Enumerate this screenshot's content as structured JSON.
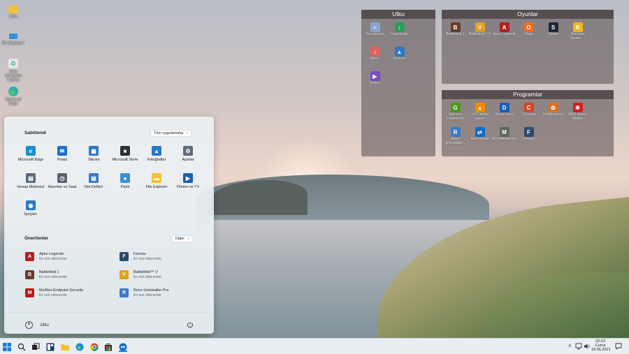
{
  "desktop": {
    "icons": [
      {
        "label": "Utku",
        "color": "#f2c233"
      },
      {
        "label": "Bu bilgisayar",
        "color": "#3a8fd8"
      },
      {
        "label": "Geri Dönüşüm Kutusu",
        "color": "#dfe6ea"
      },
      {
        "label": "Microsoft Edge",
        "color": "#1a8fd2"
      }
    ]
  },
  "fences": {
    "utku": {
      "title": "Utku",
      "items": [
        {
          "label": "Documents",
          "color": "#8aa4c8",
          "glyph": "≡"
        },
        {
          "label": "Downloads",
          "color": "#2e9e5a",
          "glyph": "↓"
        },
        {
          "label": "Music",
          "color": "#e0625c",
          "glyph": "♪"
        },
        {
          "label": "Pictures",
          "color": "#2a78c8",
          "glyph": "▲"
        },
        {
          "label": "Videos",
          "color": "#7b4bc2",
          "glyph": "▶"
        }
      ]
    },
    "oyunlar": {
      "title": "Oyunlar",
      "items": [
        {
          "label": "Battlefield 1",
          "color": "#6b3a2a",
          "glyph": "B"
        },
        {
          "label": "Battlefield™ V",
          "color": "#e0a020",
          "glyph": "V"
        },
        {
          "label": "Apex Legends",
          "color": "#b02020",
          "glyph": "A"
        },
        {
          "label": "Origin",
          "color": "#f26b1d",
          "glyph": "O"
        },
        {
          "label": "Steam",
          "color": "#1b2838",
          "glyph": "S"
        },
        {
          "label": "Rockstar Games ...",
          "color": "#f2b415",
          "glyph": "R"
        }
      ]
    },
    "programlar": {
      "title": "Programlar",
      "items": [
        {
          "label": "GeForce Experience",
          "color": "#4a9a1e",
          "glyph": "G"
        },
        {
          "label": "VLC media player",
          "color": "#f08a00",
          "glyph": "▲"
        },
        {
          "label": "Driver Easy",
          "color": "#1e5fb0",
          "glyph": "D"
        },
        {
          "label": "CCleaner",
          "color": "#d04a2a",
          "glyph": "C"
        },
        {
          "label": "Ds4Windows",
          "color": "#e07020",
          "glyph": "✿"
        },
        {
          "label": "AMD Ryzen Master",
          "color": "#d02020",
          "glyph": "✱"
        },
        {
          "label": "Revo Uninstaller...",
          "color": "#3a7ac8",
          "glyph": "R"
        },
        {
          "label": "TeamViewer",
          "color": "#0e6bd0",
          "glyph": "⇄"
        },
        {
          "label": "MSI Afterburner",
          "color": "#5a6a5a",
          "glyph": "M"
        },
        {
          "label": "Fences",
          "color": "#2a4a6a",
          "glyph": "F"
        }
      ]
    }
  },
  "start": {
    "pinned_title": "Sabitlendi",
    "all_apps_label": "Tüm uygulamalar",
    "pinned": [
      {
        "label": "Microsoft Edge",
        "color": "#1a8fd2",
        "glyph": "e"
      },
      {
        "label": "Posta",
        "color": "#1e6fc8",
        "glyph": "✉"
      },
      {
        "label": "Takvim",
        "color": "#2a78c8",
        "glyph": "▦"
      },
      {
        "label": "Microsoft Store",
        "color": "#303030",
        "glyph": "■"
      },
      {
        "label": "Fotoğraflar",
        "color": "#2a78c8",
        "glyph": "▲"
      },
      {
        "label": "Ayarlar",
        "color": "#606c78",
        "glyph": "⚙"
      },
      {
        "label": "Hesap Makinesi",
        "color": "#5a6a7a",
        "glyph": "▤"
      },
      {
        "label": "Alarmlar ve Saat",
        "color": "#5a6270",
        "glyph": "◷"
      },
      {
        "label": "Not Defteri",
        "color": "#3a7ac8",
        "glyph": "▤"
      },
      {
        "label": "Paint",
        "color": "#3a90d0",
        "glyph": "●"
      },
      {
        "label": "File Explorer",
        "color": "#f2c233",
        "glyph": "▬"
      },
      {
        "label": "Filmler ve TV",
        "color": "#1e5fb0",
        "glyph": "▶"
      },
      {
        "label": "İpuçları",
        "color": "#2a78c8",
        "glyph": "◉"
      }
    ],
    "recommended_title": "Önerilenler",
    "more_label": "Diğer",
    "recommended": [
      {
        "title": "Apex Legends",
        "subtitle": "En son eklenenler",
        "color": "#b02020",
        "glyph": "A"
      },
      {
        "title": "Fences",
        "subtitle": "En son eklenenler",
        "color": "#2a4a6a",
        "glyph": "F"
      },
      {
        "title": "Battlefield 1",
        "subtitle": "En son eklenenler",
        "color": "#6b3a2a",
        "glyph": "B"
      },
      {
        "title": "Battlefield™ V",
        "subtitle": "En son eklenenler",
        "color": "#e0a020",
        "glyph": "V"
      },
      {
        "title": "McAfee Endpoint Security",
        "subtitle": "En son eklenenler",
        "color": "#c01818",
        "glyph": "M"
      },
      {
        "title": "Revo Uninstaller Pro",
        "subtitle": "En son eklenenler",
        "color": "#3a7ac8",
        "glyph": "R"
      }
    ],
    "user_name": "Utku"
  },
  "taskbar": {
    "time": "22:23",
    "day": "Cuma",
    "date": "18.06.2021"
  }
}
